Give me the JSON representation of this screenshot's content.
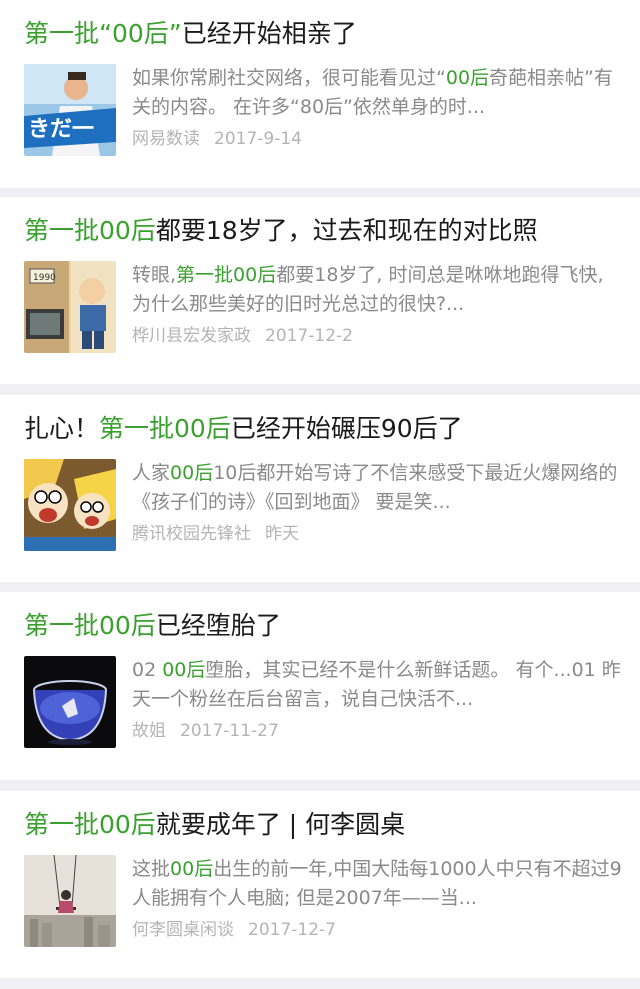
{
  "articles": [
    {
      "title": [
        {
          "t": "第一批",
          "h": true
        },
        {
          "t": "“00后”",
          "h": true
        },
        {
          "t": "已经开始相亲了",
          "h": false
        }
      ],
      "desc": [
        {
          "t": "如果你常刷社交网络，很可能看见过“",
          "h": false
        },
        {
          "t": "00后",
          "h": true
        },
        {
          "t": "奇葩相亲帖”有关的内容。 在许多“80后”依然单身的时...",
          "h": false
        }
      ],
      "source": "网易数读",
      "date": "2017-9-14",
      "thumb_icon": "person-banner-image"
    },
    {
      "title": [
        {
          "t": "第一批00后",
          "h": true
        },
        {
          "t": "都要18岁了，过去和现在的对比照",
          "h": false
        }
      ],
      "desc": [
        {
          "t": "转眼,",
          "h": false
        },
        {
          "t": "第一批00后",
          "h": true
        },
        {
          "t": "都要18岁了, 时间总是咻咻地跑得飞快,为什么那些美好的旧时光总过的很快?...",
          "h": false
        }
      ],
      "source": "桦川县宏发家政",
      "date": "2017-12-2",
      "thumb_icon": "cartoon-comparison-image"
    },
    {
      "title": [
        {
          "t": "扎心！",
          "h": false
        },
        {
          "t": "第一批00后",
          "h": true
        },
        {
          "t": "已经开始碾压90后了",
          "h": false
        }
      ],
      "desc": [
        {
          "t": "人家",
          "h": false
        },
        {
          "t": "00后",
          "h": true
        },
        {
          "t": "10后都开始写诗了不信来感受下最近火爆网络的 《孩子们的诗》《回到地面》 要是笑...",
          "h": false
        }
      ],
      "source": "腾讯校园先锋社",
      "date": "昨天",
      "thumb_icon": "shocked-cartoon-image"
    },
    {
      "title": [
        {
          "t": "第一批00后",
          "h": true
        },
        {
          "t": "已经堕胎了",
          "h": false
        }
      ],
      "desc": [
        {
          "t": "02 ",
          "h": false
        },
        {
          "t": "00后",
          "h": true
        },
        {
          "t": "堕胎，其实已经不是什么新鲜话题。 有个...01 昨天一个粉丝在后台留言，说自己快活不...",
          "h": false
        }
      ],
      "source": "故姐",
      "date": "2017-11-27",
      "thumb_icon": "glass-bowl-image"
    },
    {
      "title": [
        {
          "t": "第一批00后",
          "h": true
        },
        {
          "t": "就要成年了 | 何李圆桌",
          "h": false
        }
      ],
      "desc": [
        {
          "t": "这批",
          "h": false
        },
        {
          "t": "00后",
          "h": true
        },
        {
          "t": "出生的前一年,中国大陆每1000人中只有不超过9人能拥有个人电脑; 但是2007年——当...",
          "h": false
        }
      ],
      "source": "何李圆桌闲谈",
      "date": "2017-12-7",
      "thumb_icon": "swing-city-image"
    }
  ],
  "thumb_text": {
    "banner": "きだ一",
    "year": "1990"
  },
  "colors": {
    "highlight": "#3aa12f",
    "title": "#1a1a1a",
    "desc": "#8a8a8a",
    "meta": "#b4b4b4",
    "background": "#efeff4"
  }
}
